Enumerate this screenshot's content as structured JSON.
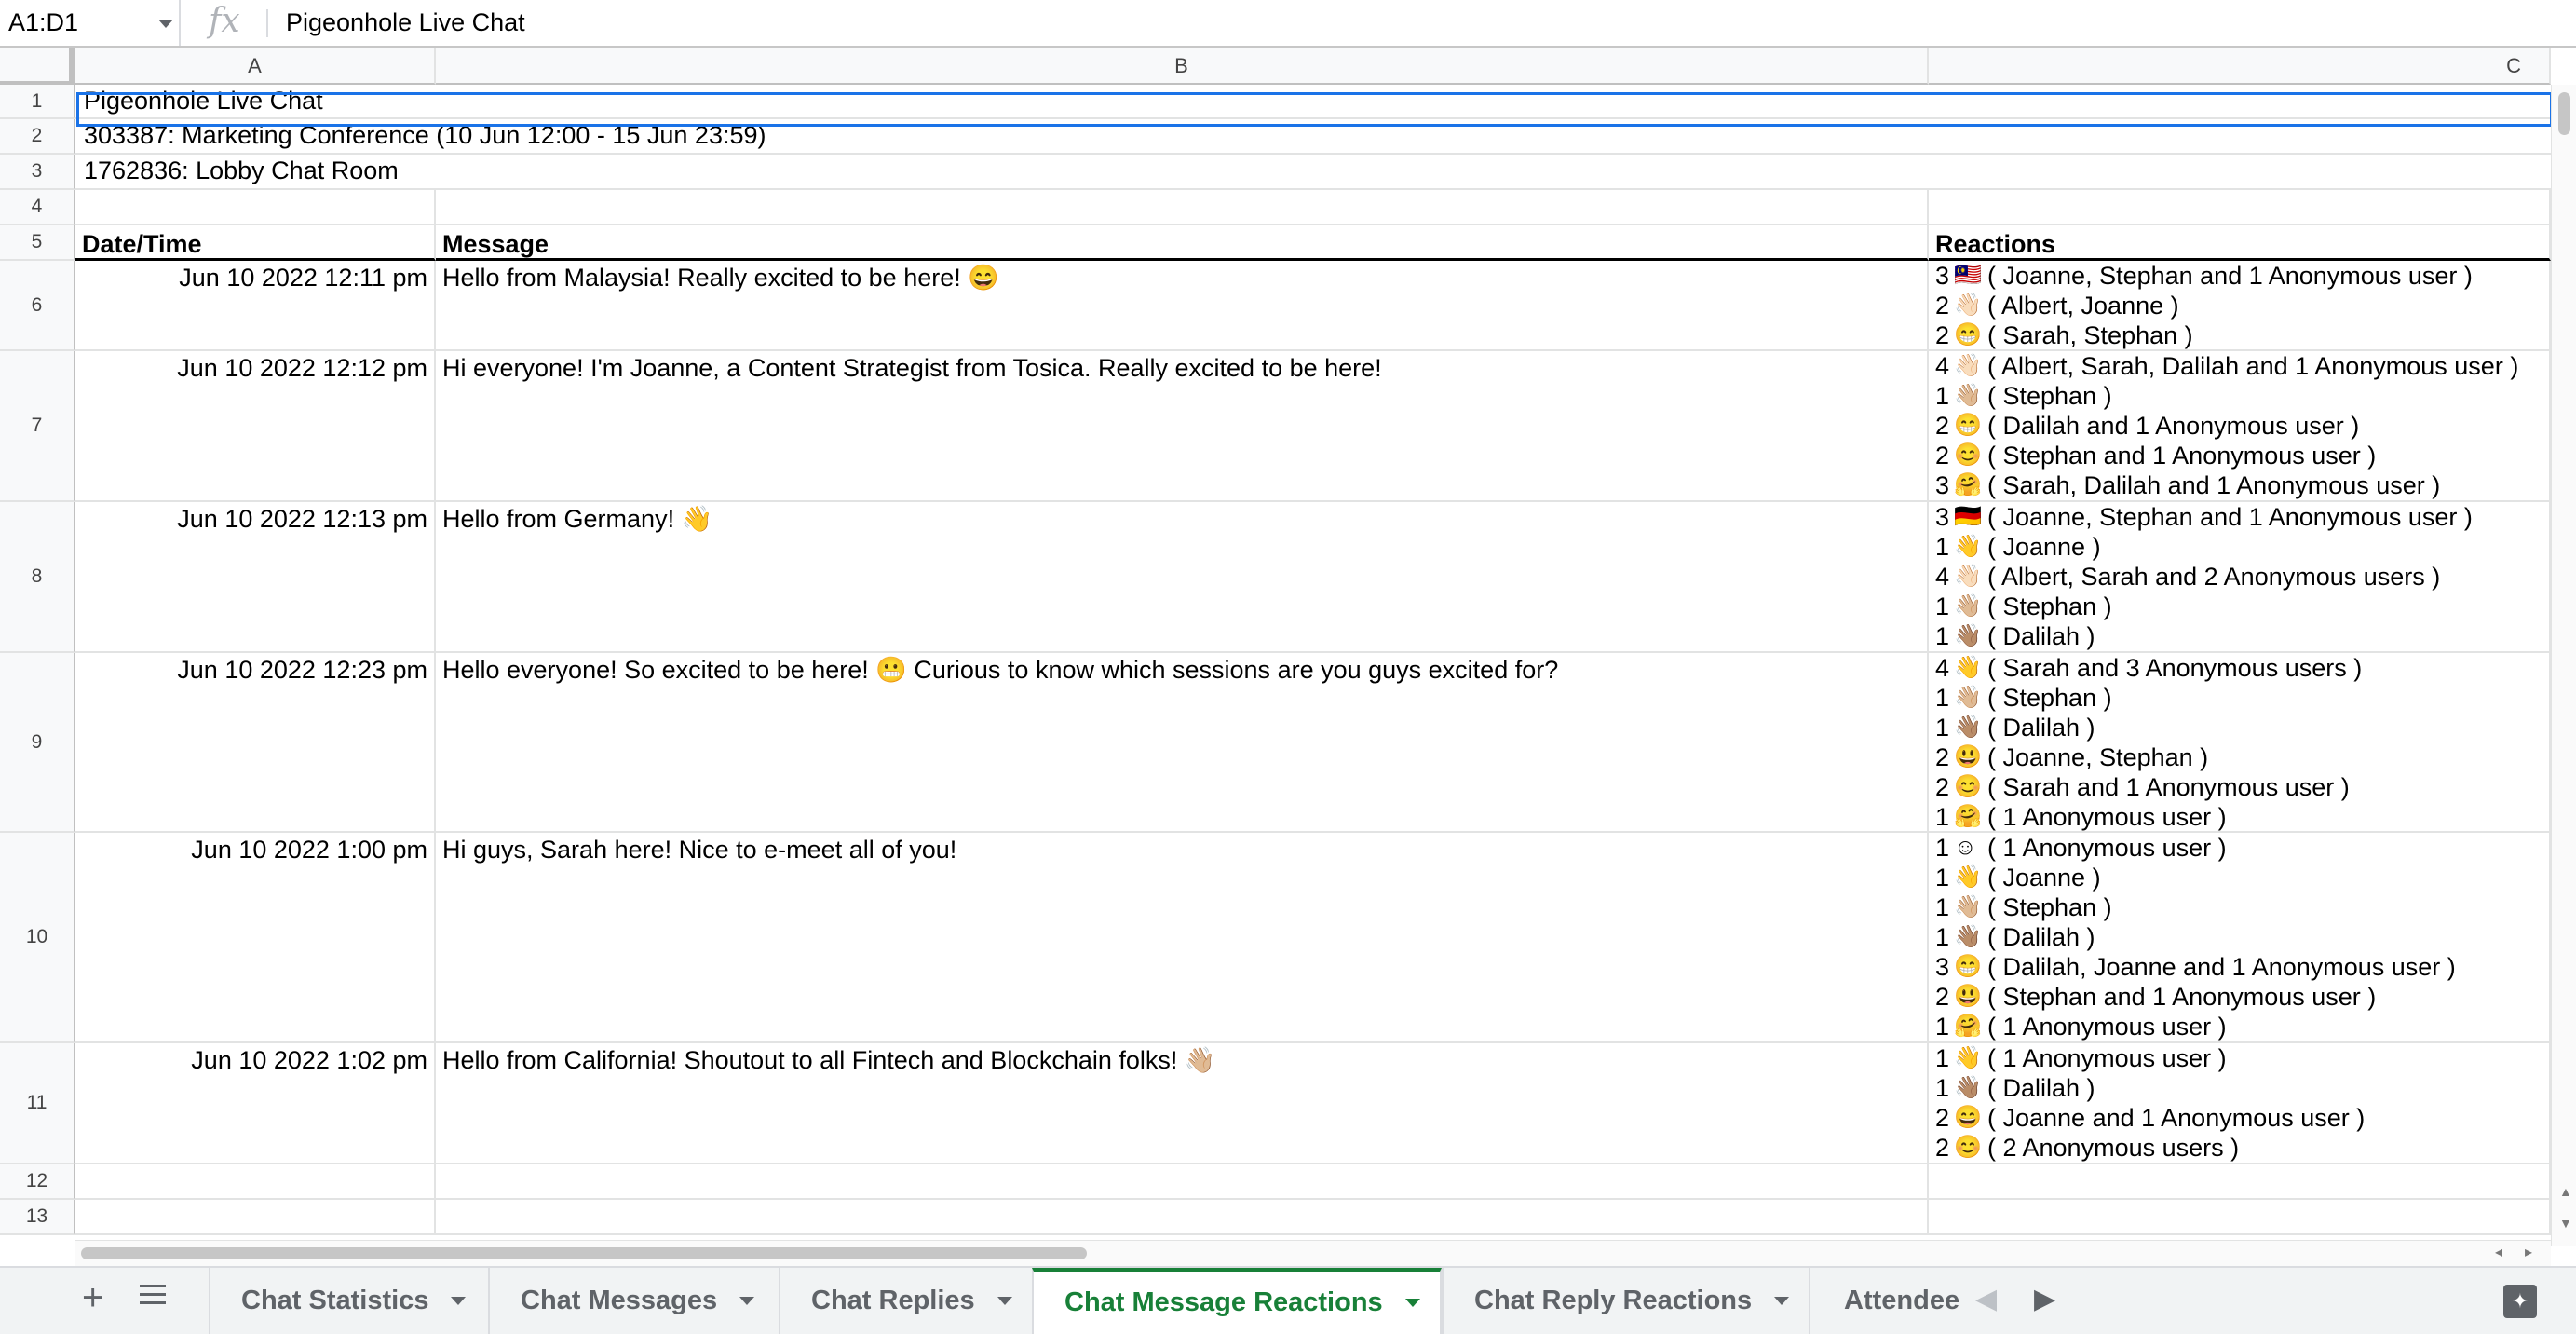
{
  "formula_bar": {
    "name_box": "A1:D1",
    "fx": "fx",
    "content": "Pigeonhole Live Chat"
  },
  "columns": [
    "A",
    "B",
    "C"
  ],
  "row_numbers": [
    "1",
    "2",
    "3",
    "4",
    "5",
    "6",
    "7",
    "8",
    "9",
    "10",
    "11",
    "12",
    "13"
  ],
  "sheet": {
    "title": "Pigeonhole Live Chat",
    "event": "303387: Marketing Conference (10 Jun 12:00 - 15 Jun 23:59)",
    "room": "1762836: Lobby Chat Room",
    "headers": {
      "datetime": "Date/Time",
      "message": "Message",
      "reactions": "Reactions"
    },
    "messages": [
      {
        "datetime": "Jun 10 2022 12:11 pm",
        "text": "Hello from Malaysia! Really excited to be here! 😄",
        "reactions": [
          {
            "count": "3",
            "emoji": "🇲🇾",
            "users": "( Joanne, Stephan and 1 Anonymous user )"
          },
          {
            "count": "2",
            "emoji": "👋🏻",
            "users": "( Albert, Joanne )"
          },
          {
            "count": "2",
            "emoji": "😁",
            "users": "( Sarah, Stephan )"
          }
        ]
      },
      {
        "datetime": "Jun 10 2022 12:12 pm",
        "text": "Hi everyone! I'm Joanne, a Content Strategist from Tosica. Really excited to be here!",
        "reactions": [
          {
            "count": "4",
            "emoji": "👋🏻",
            "users": "( Albert, Sarah, Dalilah and 1 Anonymous user )"
          },
          {
            "count": "1",
            "emoji": "👋🏼",
            "users": "( Stephan )"
          },
          {
            "count": "2",
            "emoji": "😁",
            "users": "( Dalilah and 1 Anonymous user )"
          },
          {
            "count": "2",
            "emoji": "😊",
            "users": "( Stephan and 1 Anonymous user )"
          },
          {
            "count": "3",
            "emoji": "🤗",
            "users": "( Sarah, Dalilah and 1 Anonymous user )"
          }
        ]
      },
      {
        "datetime": "Jun 10 2022 12:13 pm",
        "text": "Hello from Germany! 👋",
        "reactions": [
          {
            "count": "3",
            "emoji": "🇩🇪",
            "users": "( Joanne, Stephan and 1 Anonymous user )"
          },
          {
            "count": "1",
            "emoji": "👋",
            "users": "( Joanne )"
          },
          {
            "count": "4",
            "emoji": "👋🏻",
            "users": "( Albert, Sarah and 2 Anonymous users )"
          },
          {
            "count": "1",
            "emoji": "👋🏼",
            "users": "( Stephan )"
          },
          {
            "count": "1",
            "emoji": "👋🏽",
            "users": "( Dalilah )"
          }
        ]
      },
      {
        "datetime": "Jun 10 2022 12:23 pm",
        "text": "Hello everyone! So excited to be here! 😬  Curious to know which sessions are you guys excited for?",
        "reactions": [
          {
            "count": "4",
            "emoji": "👋",
            "users": "( Sarah and 3 Anonymous users )"
          },
          {
            "count": "1",
            "emoji": "👋🏼",
            "users": "( Stephan )"
          },
          {
            "count": "1",
            "emoji": "👋🏽",
            "users": "( Dalilah )"
          },
          {
            "count": "2",
            "emoji": "😃",
            "users": "( Joanne, Stephan )"
          },
          {
            "count": "2",
            "emoji": "😊",
            "users": "( Sarah and 1 Anonymous user )"
          },
          {
            "count": "1",
            "emoji": "🤗",
            "users": "( 1 Anonymous user )"
          }
        ]
      },
      {
        "datetime": "Jun 10 2022 1:00 pm",
        "text": "Hi guys, Sarah here! Nice to e-meet all of you!",
        "reactions": [
          {
            "count": "1",
            "emoji": "☺",
            "users": "( 1 Anonymous user )"
          },
          {
            "count": "1",
            "emoji": "👋",
            "users": "( Joanne )"
          },
          {
            "count": "1",
            "emoji": "👋🏼",
            "users": "( Stephan )"
          },
          {
            "count": "1",
            "emoji": "👋🏽",
            "users": "( Dalilah )"
          },
          {
            "count": "3",
            "emoji": "😁",
            "users": "( Dalilah, Joanne and 1 Anonymous user )"
          },
          {
            "count": "2",
            "emoji": "😃",
            "users": "( Stephan and 1 Anonymous user )"
          },
          {
            "count": "1",
            "emoji": "🤗",
            "users": "( 1 Anonymous user )"
          }
        ]
      },
      {
        "datetime": "Jun 10 2022 1:02 pm",
        "text": "Hello from California! Shoutout to all Fintech and Blockchain folks! 👋🏼",
        "reactions": [
          {
            "count": "1",
            "emoji": "👋",
            "users": "( 1 Anonymous user )"
          },
          {
            "count": "1",
            "emoji": "👋🏽",
            "users": "( Dalilah )"
          },
          {
            "count": "2",
            "emoji": "😄",
            "users": "( Joanne and 1 Anonymous user )"
          },
          {
            "count": "2",
            "emoji": "😊",
            "users": "( 2 Anonymous users )"
          }
        ]
      }
    ]
  },
  "tabs": {
    "add_icon": "+",
    "items": [
      {
        "label": "Chat Statistics",
        "active": false
      },
      {
        "label": "Chat Messages",
        "active": false
      },
      {
        "label": "Chat Replies",
        "active": false
      },
      {
        "label": "Chat Message Reactions",
        "active": true
      },
      {
        "label": "Chat Reply Reactions",
        "active": false
      },
      {
        "label": "Attendee",
        "active": false
      }
    ],
    "active_color": "#188038"
  },
  "colors": {
    "selection": "#1a73e8",
    "header_bg": "#f8f9fa",
    "gridline": "#e2e3e3"
  }
}
